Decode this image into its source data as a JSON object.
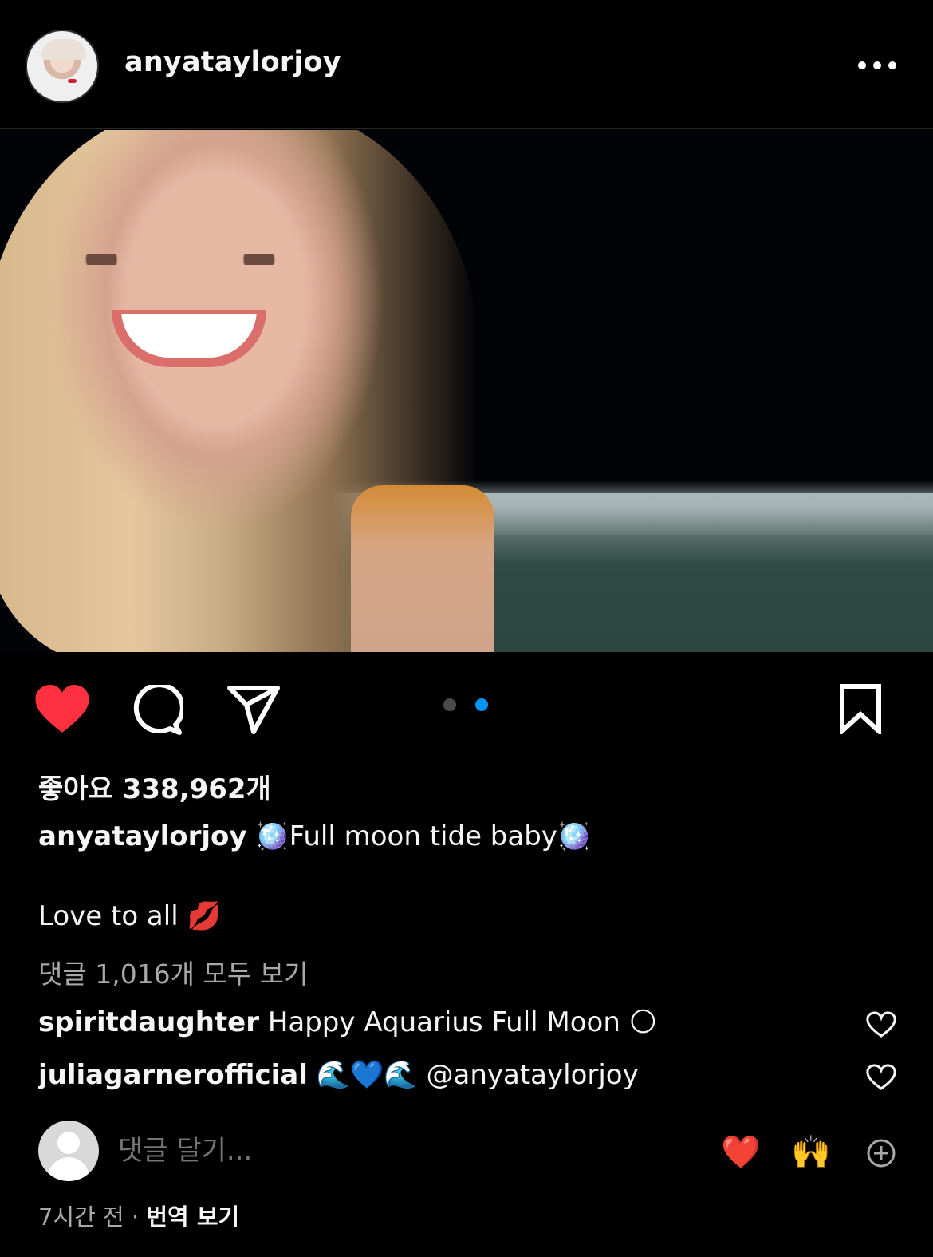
{
  "post": {
    "username": "anyataylorjoy",
    "more_label": "···",
    "likes_text": "좋아요 338,962개",
    "caption_username": "anyataylorjoy",
    "caption_text": "🪩Full moon tide baby🪩",
    "caption_line2": "Love to all 💋",
    "view_comments": "댓글 1,016개 모두 보기",
    "comments": [
      {
        "username": "spiritdaughter",
        "text": "Happy Aquarius Full Moon 🌕"
      },
      {
        "username": "juliagarnerofficial",
        "text": "🌊💙🌊 @anyataylorjoy"
      }
    ],
    "add_comment_placeholder": "댓글 달기...",
    "quick_reactions": [
      "❤️",
      "🙌"
    ],
    "timestamp": "7시간 전",
    "separator": "·",
    "translate": "번역 보기",
    "carousel": {
      "count": 2,
      "active_index": 1
    }
  },
  "colors": {
    "background": "#000000",
    "like": "#ff3040",
    "active_dot": "#0095f6",
    "muted_text": "#a8a8a8"
  },
  "icons": [
    "heart-filled-icon",
    "comment-icon",
    "share-icon",
    "bookmark-icon",
    "more-icon",
    "add-icon"
  ]
}
